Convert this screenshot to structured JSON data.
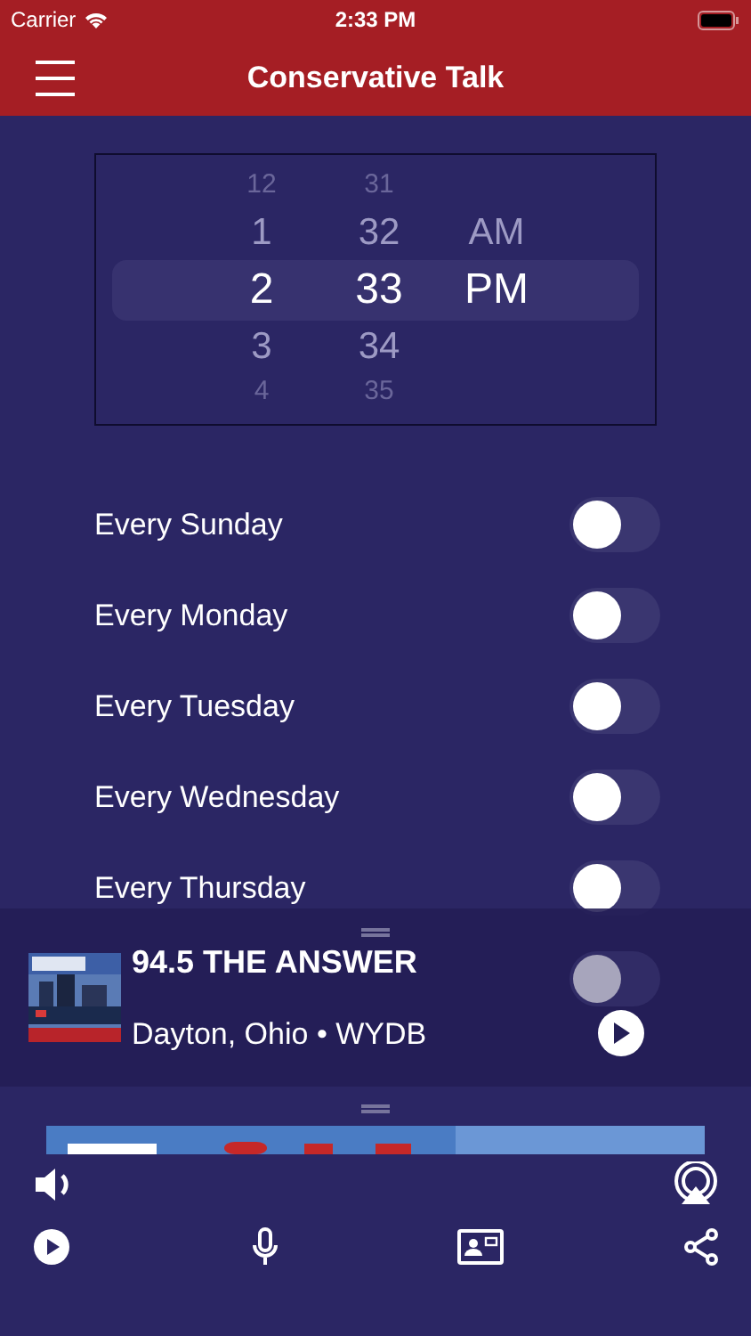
{
  "status_bar": {
    "carrier": "Carrier",
    "time": "2:33 PM"
  },
  "nav": {
    "title": "Conservative Talk"
  },
  "picker": {
    "columns": [
      {
        "items": [
          {
            "label": "12",
            "selected": false
          },
          {
            "label": "1",
            "selected": false
          },
          {
            "label": "2",
            "selected": true
          },
          {
            "label": "3",
            "selected": false
          },
          {
            "label": "4",
            "selected": false
          }
        ]
      },
      {
        "items": [
          {
            "label": "31",
            "selected": false
          },
          {
            "label": "32",
            "selected": false
          },
          {
            "label": "33",
            "selected": true
          },
          {
            "label": "34",
            "selected": false
          },
          {
            "label": "35",
            "selected": false
          }
        ]
      },
      {
        "items": [
          {
            "label": "AM",
            "selected": false
          },
          {
            "label": "PM",
            "selected": true
          }
        ]
      }
    ]
  },
  "days": [
    {
      "label": "Every Sunday",
      "on": false
    },
    {
      "label": "Every Monday",
      "on": false
    },
    {
      "label": "Every Tuesday",
      "on": false
    },
    {
      "label": "Every Wednesday",
      "on": false
    },
    {
      "label": "Every Thursday",
      "on": false
    },
    {
      "on": false
    }
  ],
  "player": {
    "station": "94.5 THE ANSWER",
    "subtitle": "Dayton, Ohio • WYDB"
  }
}
